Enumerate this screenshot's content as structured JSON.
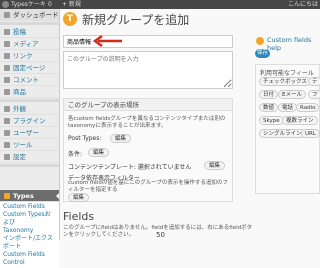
{
  "adminbar": {
    "site_name": "Typesケーキ",
    "comment_count": "0",
    "new_label": "+ 新規",
    "howdy": "こんにちは"
  },
  "sidebar": {
    "items": [
      {
        "label": "ダッシュボード"
      },
      {
        "label": "投稿"
      },
      {
        "label": "メディア"
      },
      {
        "label": "リンク"
      },
      {
        "label": "固定ページ"
      },
      {
        "label": "コメント"
      },
      {
        "label": "商品"
      },
      {
        "label": "外観"
      },
      {
        "label": "プラグイン"
      },
      {
        "label": "ユーザー"
      },
      {
        "label": "ツール"
      },
      {
        "label": "設定"
      },
      {
        "label": "Types"
      }
    ],
    "submenu": [
      "Custom Fields",
      "Custom Typesおよび",
      "Taxonomy",
      "インポート/エクスポート",
      "Custom Fields",
      "Control"
    ]
  },
  "main": {
    "title": "新規グループを追加",
    "name_value": "商品情報",
    "description_placeholder": "このグループの説明を入力",
    "help_link": "Custom fields help",
    "save_label": "保存",
    "rules_title": "利用可能なフィールド",
    "rules_tags": [
      "チェックボックス",
      "テ",
      "日付",
      "Eメール",
      "フ",
      "数値",
      "電話",
      "Radio",
      "Skype",
      "複数ライン",
      "シングルライン",
      "URL"
    ],
    "visibility": {
      "heading": "このグループの表示場所",
      "text": "各custom fieldsグループを異なるコンテンツタイプまたは別のtaxonomyに表示することが出来ます。",
      "post_types_label": "Post Types:",
      "conditions_label": "条件:",
      "content_template_label": "コンテンツテンプレート: 選択されていません",
      "data_filter_label": "データ依存表示フィルター",
      "data_filter_text": "custom fieldの値を基にこのグループの表示を操作する追加のフィルターを指定する",
      "edit_label": "編集"
    },
    "fields_title": "Fields",
    "fields_text": "このグループにfieldはありません。fieldを追加するには、右にあるfieldボタンをクリックしてください。",
    "page_number": "50"
  }
}
